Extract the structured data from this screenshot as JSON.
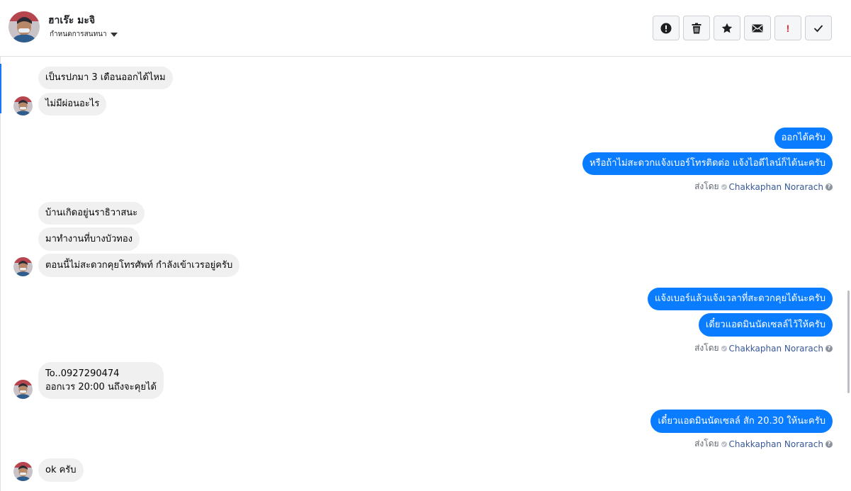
{
  "header": {
    "contact_name": "ฮาเร๊ะ มะจิ",
    "assign_label": "กำหนดการสนทนา"
  },
  "toolbar": {
    "buttons": [
      {
        "icon": "spam-alert-icon"
      },
      {
        "icon": "trash-icon"
      },
      {
        "icon": "star-icon"
      },
      {
        "icon": "mail-icon"
      },
      {
        "icon": "important-icon",
        "label": "!"
      },
      {
        "icon": "check-icon"
      }
    ],
    "important_color": "#e4252f"
  },
  "messages": {
    "m1": "เป็นรปภมา 3 เดือนออกได้ไหม",
    "m2": "ไม่มีผ่อนอะไร",
    "m3": "ออกได้ครับ",
    "m4": "หรือถ้าไม่สะดวกแจ้งเบอร์โทรติดต่อ แจ้งไอดีไลน์ก็ได้นะครับ",
    "m5": "บ้านเกิดอยู่นราธิวาสนะ",
    "m6": "มาทำงานที่บางบัวทอง",
    "m7": "ตอนนี้ไม่สะดวกคุยโทรศัพท์ กำลังเข้าเวรอยู่ครับ",
    "m8": "แจ้งเบอร์แล้วแจ้งเวลาที่สะดวกคุยได้นะครับ",
    "m9": "เดี๋ยวแอดมินนัดเซลล์ไว้ให้ครับ",
    "m10_line1": "To..0927290474",
    "m10_line2": "ออกเวร 20:00 นถึงจะคุยได้",
    "m11": "เดี๋ยวแอดมินนัดเซลล์ สัก 20.30 ให้นะครับ",
    "m12": "ok ครับ"
  },
  "sent_by": {
    "prefix": "ส่งโดย",
    "agent": "Chakkaphan Norarach",
    "help": "?"
  },
  "colors": {
    "outgoing": "#0a7cff",
    "incoming": "#f0f0f0",
    "accent": "#1877f2"
  }
}
